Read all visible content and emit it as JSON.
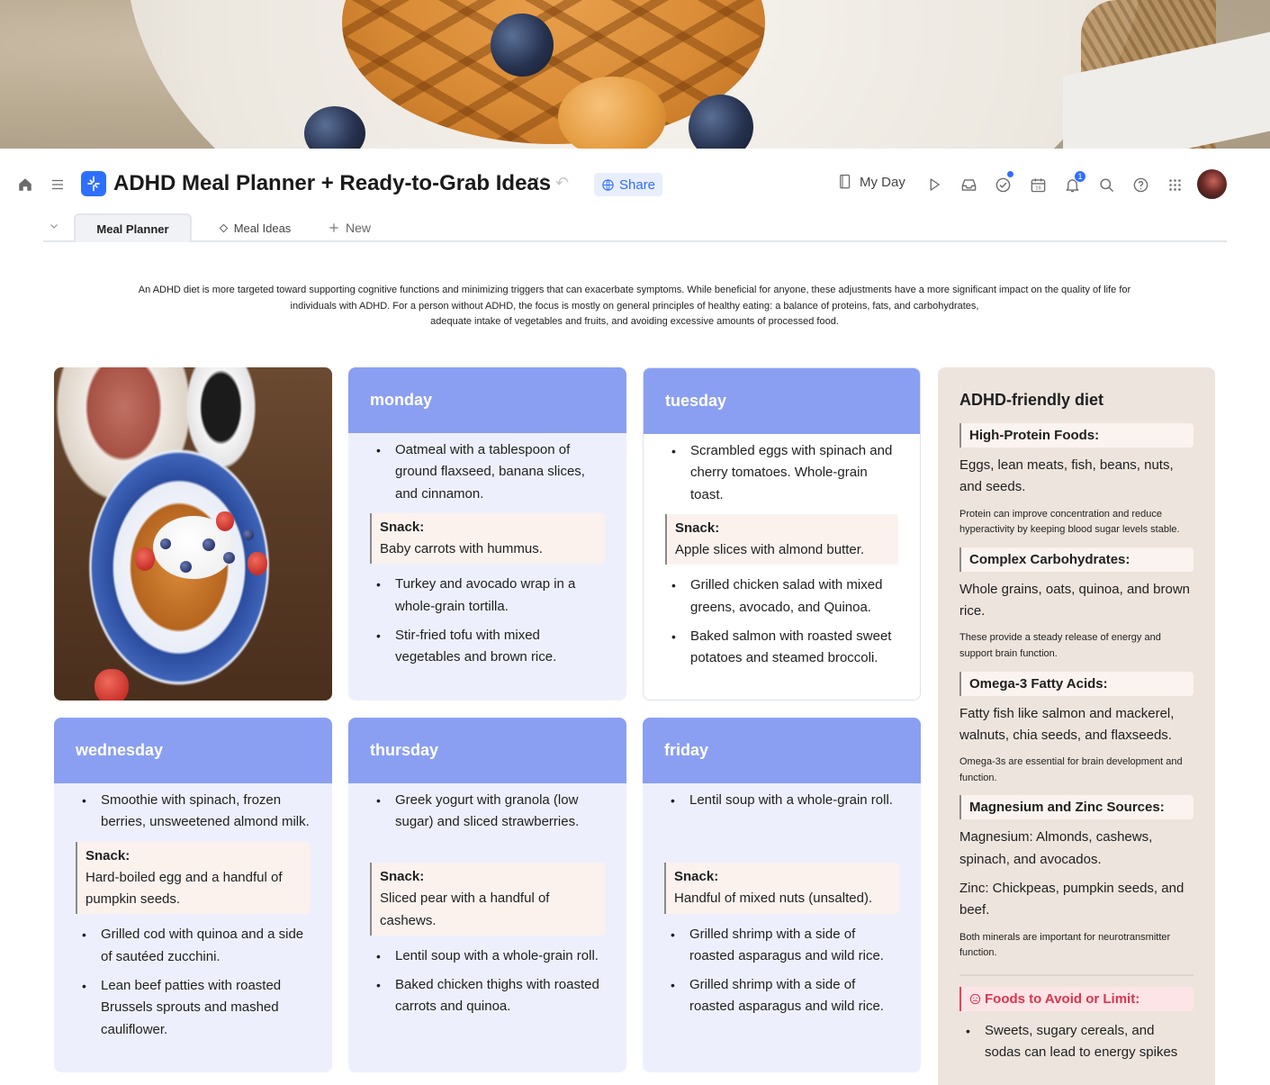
{
  "header": {
    "title": "ADHD Meal Planner + Ready-to-Grab Ideas",
    "more": "···",
    "share_label": "Share",
    "my_day_label": "My Day",
    "notification_count": "1"
  },
  "tabs": {
    "items": [
      {
        "label": "Meal Planner",
        "active": true
      },
      {
        "label": "Meal Ideas",
        "active": false
      }
    ],
    "new_label": "New"
  },
  "intro": {
    "line1": "An ADHD diet is more targeted toward supporting cognitive functions and minimizing triggers that can exacerbate symptoms. While beneficial for anyone, these adjustments have a more significant impact on the quality of life for",
    "line2": "individuals with ADHD. For a person without ADHD, the focus is mostly on general principles of healthy eating: a balance of proteins, fats, and carbohydrates,",
    "line3": "adequate intake of vegetables and fruits, and avoiding excessive amounts of processed food."
  },
  "days": {
    "monday": {
      "name": "monday",
      "breakfast": "Oatmeal with a tablespoon of ground flaxseed, banana slices, and cinnamon.",
      "snack_label": "Snack:",
      "snack": "Baby carrots with hummus.",
      "lunch": "Turkey and avocado wrap in a whole-grain tortilla.",
      "dinner": "Stir-fried tofu with mixed vegetables and brown rice."
    },
    "tuesday": {
      "name": "tuesday",
      "breakfast": "Scrambled eggs with spinach and cherry tomatoes. Whole-grain toast.",
      "snack_label": "Snack:",
      "snack": "Apple slices with almond butter.",
      "lunch": "Grilled chicken salad with mixed greens, avocado, and Quinoa.",
      "dinner": "Baked salmon with roasted sweet potatoes and steamed broccoli."
    },
    "wednesday": {
      "name": "wednesday",
      "breakfast": "Smoothie with spinach, frozen berries, unsweetened almond milk.",
      "snack_label": "Snack:",
      "snack": "Hard-boiled egg and a handful of pumpkin seeds.",
      "lunch": "Grilled cod with quinoa and a side of sautéed zucchini.",
      "dinner": "Lean beef patties with roasted Brussels sprouts and mashed cauliflower."
    },
    "thursday": {
      "name": "thursday",
      "breakfast": "Greek yogurt with granola (low sugar) and sliced strawberries.",
      "snack_label": "Snack:",
      "snack": "Sliced pear with a handful of cashews.",
      "lunch": "Lentil soup with a whole-grain roll.",
      "dinner": "Baked chicken thighs with roasted carrots and quinoa."
    },
    "friday": {
      "name": "friday",
      "breakfast": "Lentil soup with a whole-grain roll.",
      "snack_label": "Snack:",
      "snack": "Handful of mixed nuts (unsalted).",
      "lunch": "Grilled shrimp with a side of roasted asparagus and wild rice.",
      "dinner": "Grilled shrimp with a side of roasted asparagus and wild rice."
    }
  },
  "diet": {
    "title": "ADHD-friendly diet",
    "sections": [
      {
        "heading": "High-Protein Foods:",
        "text": "Eggs, lean meats, fish, beans, nuts, and seeds.",
        "note": "Protein can improve concentration and reduce hyperactivity by keeping blood sugar levels stable."
      },
      {
        "heading": "Complex Carbohydrates:",
        "text": "Whole grains, oats, quinoa, and brown rice.",
        "note": "These provide a steady release of energy and support brain function."
      },
      {
        "heading": "Omega-3 Fatty Acids:",
        "text": "Fatty fish like salmon and mackerel, walnuts, chia seeds, and flaxseeds.",
        "note": "Omega-3s are essential for brain development and function."
      },
      {
        "heading": "Magnesium and Zinc Sources:",
        "text": "Magnesium: Almonds, cashews, spinach, and avocados.",
        "text2": "Zinc: Chickpeas, pumpkin seeds, and beef.",
        "note": "Both minerals are important for neurotransmitter function."
      }
    ],
    "avoid": {
      "heading": "Foods to Avoid or Limit:",
      "icon": "sad-face-icon",
      "item1": "Sweets, sugary cereals, and sodas can lead to energy spikes"
    }
  },
  "colors": {
    "accent": "#2f6fff",
    "day_header": "#8a9ff2",
    "day_body": "#edf0fc",
    "diet_bg": "#ede4dd",
    "snack_bg": "#fbf2ee",
    "avoid": "#d9364f"
  }
}
